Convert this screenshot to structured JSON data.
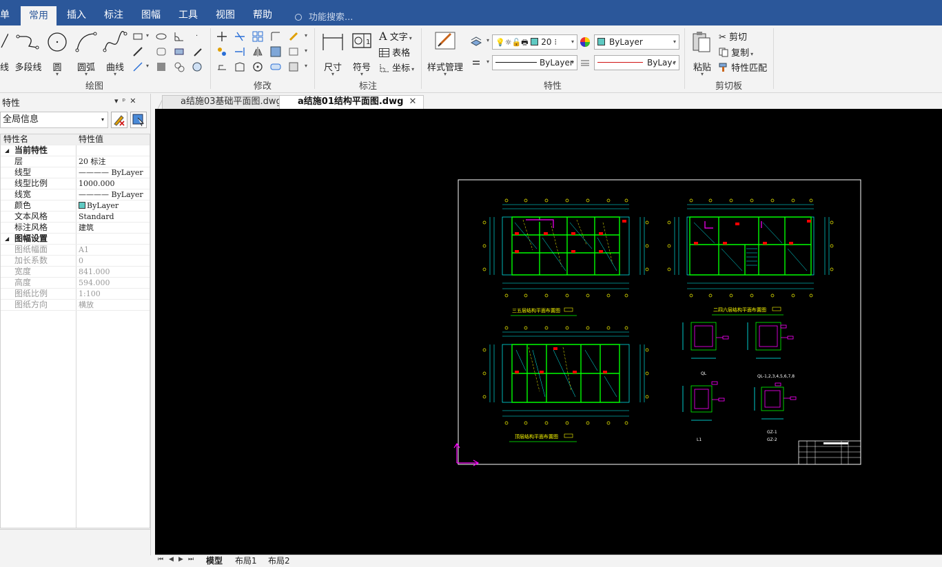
{
  "menu": {
    "items": [
      "单",
      "常用",
      "插入",
      "标注",
      "图幅",
      "工具",
      "视图",
      "帮助"
    ],
    "active": "常用",
    "search_placeholder": "功能搜索..."
  },
  "ribbon": {
    "draw": {
      "line_label": "线",
      "polyline_label": "多段线",
      "circle_label": "圆",
      "arc_label": "圆弧",
      "curve_label": "曲线",
      "group_label": "绘图"
    },
    "modify": {
      "group_label": "修改"
    },
    "annotate": {
      "dimension_label": "尺寸",
      "symbol_label": "符号",
      "text_label": "文字",
      "table_label": "表格",
      "coord_label": "坐标",
      "group_label": "标注"
    },
    "properties": {
      "style_mgr_label": "样式管理",
      "layer_value": "20 ⁝",
      "color_value": "ByLayer",
      "linetype_value": "ByLayer",
      "lineweight_value": "ByLay‹",
      "group_label": "特性"
    },
    "clipboard": {
      "paste_label": "粘贴",
      "cut_label": "剪切",
      "copy_label": "复制",
      "match_label": "特性匹配",
      "group_label": "剪切板"
    }
  },
  "props_panel": {
    "title": "特性",
    "selector": "全局信息",
    "col_name": "特性名",
    "col_value": "特性值",
    "cat_current": "当前特性",
    "rows_current": [
      {
        "k": "层",
        "v": "20 标注"
      },
      {
        "k": "线型",
        "v": "———— ByLayer"
      },
      {
        "k": "线型比例",
        "v": "1000.000"
      },
      {
        "k": "线宽",
        "v": "———— ByLayer"
      },
      {
        "k": "颜色",
        "v": "ByLayer"
      },
      {
        "k": "文本风格",
        "v": "Standard"
      },
      {
        "k": "标注风格",
        "v": "建筑"
      }
    ],
    "cat_sheet": "图幅设置",
    "rows_sheet": [
      {
        "k": "图纸幅面",
        "v": "A1"
      },
      {
        "k": "加长系数",
        "v": "0"
      },
      {
        "k": "宽度",
        "v": "841.000"
      },
      {
        "k": "高度",
        "v": "594.000"
      },
      {
        "k": "图纸比例",
        "v": "1:100"
      },
      {
        "k": "图纸方向",
        "v": "横放"
      }
    ]
  },
  "doc_tabs": [
    {
      "label": "a结施03基础平面图.dwg",
      "active": false
    },
    {
      "label": "a结施01结构平面图.dwg",
      "active": true
    }
  ],
  "drawing": {
    "plan_titles": [
      "三五层结构平面布置图",
      "二四六层结构平面布置图",
      "顶层结构平面布置图"
    ],
    "section_labels": [
      "QL",
      "QL-1,2,3,4,5,6,7,8",
      "L1",
      "GZ-1",
      "GZ-2"
    ]
  },
  "layout_tabs": [
    "模型",
    "布局1",
    "布局2"
  ],
  "colors": {
    "accent": "#2b579a",
    "canvas": "#000000",
    "cad_cyan": "#00ffff",
    "cad_green": "#00ff00",
    "cad_red": "#ff0000",
    "cad_magenta": "#ff00ff",
    "cad_yellow": "#ffff00"
  }
}
